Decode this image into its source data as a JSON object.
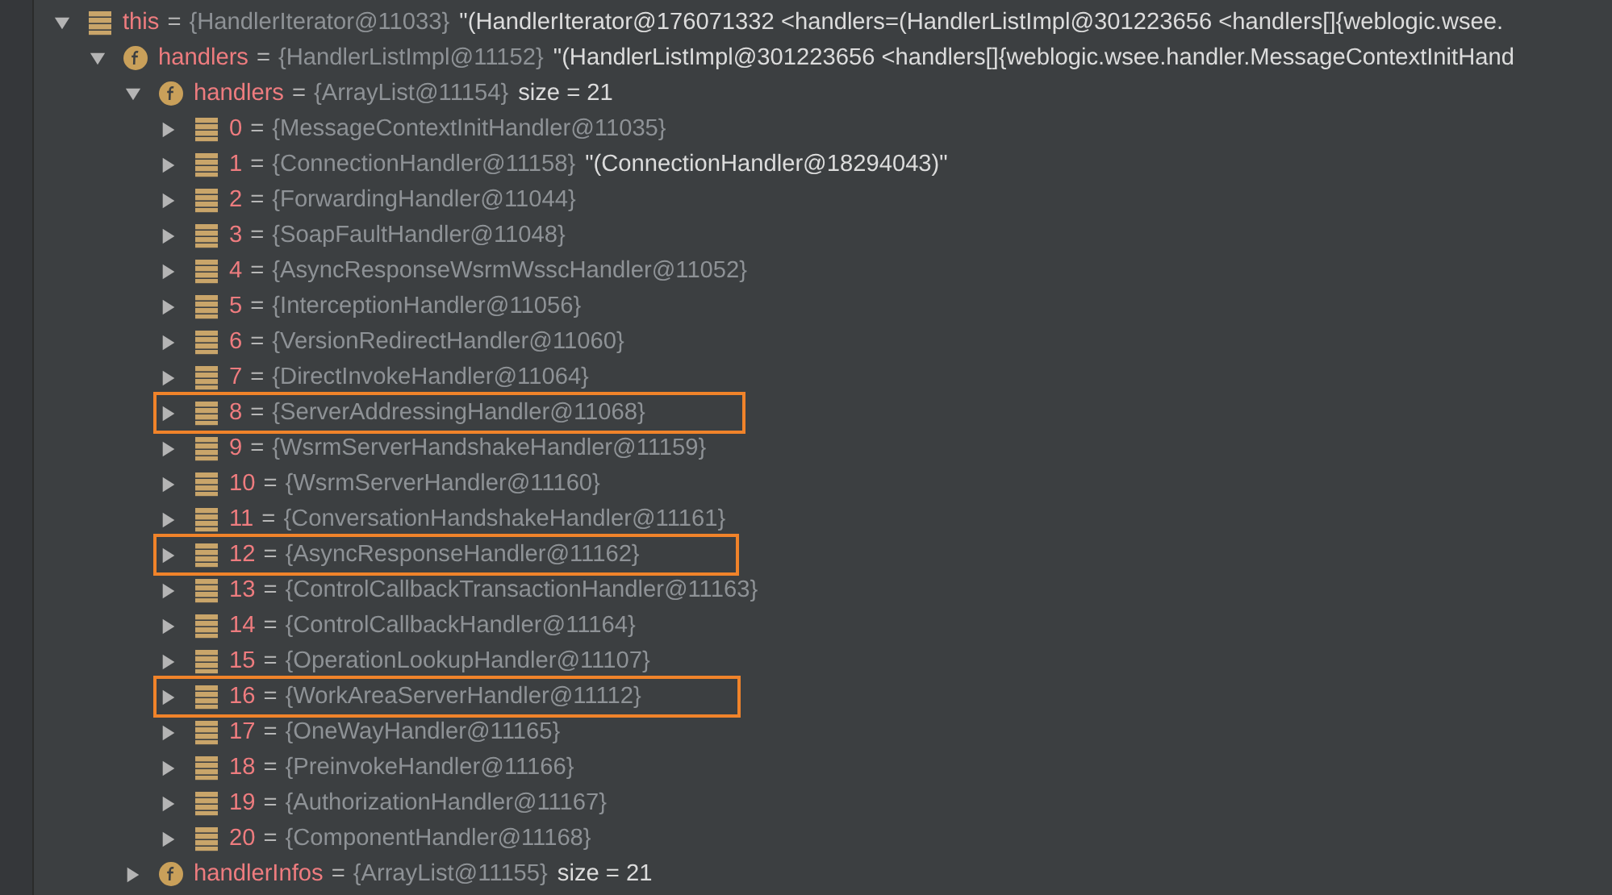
{
  "tree": [
    {
      "name": "this",
      "sep": "=",
      "value": "{HandlerIterator@11033}",
      "extra": "\"(HandlerIterator@176071332 <handlers=(HandlerListImpl@301223656 <handlers[]{weblogic.wsee.",
      "kind": "object",
      "expanded": true,
      "children": [
        {
          "name": "handlers",
          "sep": "=",
          "value": "{HandlerListImpl@11152}",
          "extra": "\"(HandlerListImpl@301223656 <handlers[]{weblogic.wsee.handler.MessageContextInitHand",
          "kind": "field",
          "expanded": true,
          "children": [
            {
              "name": "handlers",
              "sep": "=",
              "value": "{ArrayList@11154}",
              "extra": "size = 21",
              "kind": "field",
              "expanded": true,
              "children": [
                {
                  "name": "0",
                  "sep": "=",
                  "value": "{MessageContextInitHandler@11035}",
                  "kind": "object",
                  "expanded": false,
                  "highlighted": false
                },
                {
                  "name": "1",
                  "sep": "=",
                  "value": "{ConnectionHandler@11158}",
                  "extra": "\"(ConnectionHandler@18294043)\"",
                  "kind": "object",
                  "expanded": false,
                  "highlighted": false
                },
                {
                  "name": "2",
                  "sep": "=",
                  "value": "{ForwardingHandler@11044}",
                  "kind": "object",
                  "expanded": false,
                  "highlighted": false
                },
                {
                  "name": "3",
                  "sep": "=",
                  "value": "{SoapFaultHandler@11048}",
                  "kind": "object",
                  "expanded": false,
                  "highlighted": false
                },
                {
                  "name": "4",
                  "sep": "=",
                  "value": "{AsyncResponseWsrmWsscHandler@11052}",
                  "kind": "object",
                  "expanded": false,
                  "highlighted": false
                },
                {
                  "name": "5",
                  "sep": "=",
                  "value": "{InterceptionHandler@11056}",
                  "kind": "object",
                  "expanded": false,
                  "highlighted": false
                },
                {
                  "name": "6",
                  "sep": "=",
                  "value": "{VersionRedirectHandler@11060}",
                  "kind": "object",
                  "expanded": false,
                  "highlighted": false
                },
                {
                  "name": "7",
                  "sep": "=",
                  "value": "{DirectInvokeHandler@11064}",
                  "kind": "object",
                  "expanded": false,
                  "highlighted": false
                },
                {
                  "name": "8",
                  "sep": "=",
                  "value": "{ServerAddressingHandler@11068}",
                  "kind": "object",
                  "expanded": false,
                  "highlighted": true
                },
                {
                  "name": "9",
                  "sep": "=",
                  "value": "{WsrmServerHandshakeHandler@11159}",
                  "kind": "object",
                  "expanded": false,
                  "highlighted": false
                },
                {
                  "name": "10",
                  "sep": "=",
                  "value": "{WsrmServerHandler@11160}",
                  "kind": "object",
                  "expanded": false,
                  "highlighted": false
                },
                {
                  "name": "11",
                  "sep": "=",
                  "value": "{ConversationHandshakeHandler@11161}",
                  "kind": "object",
                  "expanded": false,
                  "highlighted": false
                },
                {
                  "name": "12",
                  "sep": "=",
                  "value": "{AsyncResponseHandler@11162}",
                  "kind": "object",
                  "expanded": false,
                  "highlighted": true
                },
                {
                  "name": "13",
                  "sep": "=",
                  "value": "{ControlCallbackTransactionHandler@11163}",
                  "kind": "object",
                  "expanded": false,
                  "highlighted": false
                },
                {
                  "name": "14",
                  "sep": "=",
                  "value": "{ControlCallbackHandler@11164}",
                  "kind": "object",
                  "expanded": false,
                  "highlighted": false
                },
                {
                  "name": "15",
                  "sep": "=",
                  "value": "{OperationLookupHandler@11107}",
                  "kind": "object",
                  "expanded": false,
                  "highlighted": false
                },
                {
                  "name": "16",
                  "sep": "=",
                  "value": "{WorkAreaServerHandler@11112}",
                  "kind": "object",
                  "expanded": false,
                  "highlighted": true
                },
                {
                  "name": "17",
                  "sep": "=",
                  "value": "{OneWayHandler@11165}",
                  "kind": "object",
                  "expanded": false,
                  "highlighted": false
                },
                {
                  "name": "18",
                  "sep": "=",
                  "value": "{PreinvokeHandler@11166}",
                  "kind": "object",
                  "expanded": false,
                  "highlighted": false
                },
                {
                  "name": "19",
                  "sep": "=",
                  "value": "{AuthorizationHandler@11167}",
                  "kind": "object",
                  "expanded": false,
                  "highlighted": false
                },
                {
                  "name": "20",
                  "sep": "=",
                  "value": "{ComponentHandler@11168}",
                  "kind": "object",
                  "expanded": false,
                  "highlighted": false
                }
              ]
            },
            {
              "name": "handlerInfos",
              "sep": "=",
              "value": "{ArrayList@11155}",
              "extra": "size = 21",
              "kind": "field",
              "expanded": false
            }
          ]
        }
      ]
    }
  ]
}
